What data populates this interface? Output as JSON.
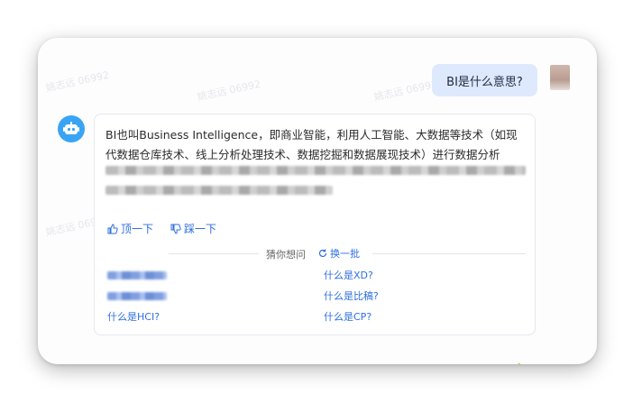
{
  "watermark_text": "姚志远 06992",
  "question": {
    "text": "BI是什么意思?"
  },
  "answer": {
    "visible_text": "BI也叫Business Intelligence，即商业智能，利用人工智能、大数据等技术（如现代数据仓库技术、线上分析处理技术、数据挖掘和数据展现技术）进行数据分析"
  },
  "feedback": {
    "like_label": "顶一下",
    "dislike_label": "踩一下"
  },
  "suggestions": {
    "header_label": "猜你想问",
    "refresh_label": "换一批",
    "left_items": [
      "",
      "",
      "什么是HCI?"
    ],
    "right_items": [
      "什么是XD?",
      "什么是比稿?",
      "什么是CP?"
    ]
  },
  "colors": {
    "accent_blue": "#2f6fe0",
    "bot_avatar": "#3aa4f4",
    "user_bubble": "#dfe9fd"
  }
}
